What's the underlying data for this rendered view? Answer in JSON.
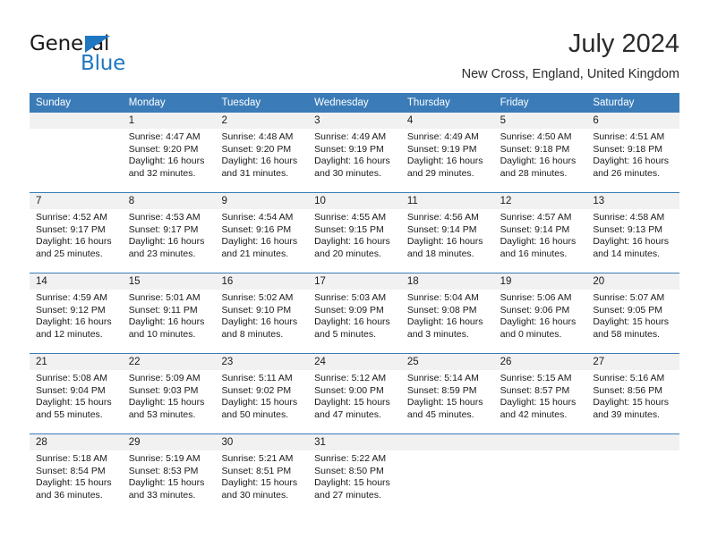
{
  "brand": {
    "word_one": "General",
    "word_two": "Blue",
    "triangle_color": "#1f77c2"
  },
  "header": {
    "month_title": "July 2024",
    "location": "New Cross, England, United Kingdom",
    "header_bg": "#3b7cb8",
    "number_band_bg": "#f1f1f1"
  },
  "calendar": {
    "weekday_headers": [
      "Sunday",
      "Monday",
      "Tuesday",
      "Wednesday",
      "Thursday",
      "Friday",
      "Saturday"
    ],
    "weeks": [
      [
        {
          "day": "",
          "sunrise": "",
          "sunset": "",
          "daylight_line1": "",
          "daylight_line2": ""
        },
        {
          "day": "1",
          "sunrise": "Sunrise: 4:47 AM",
          "sunset": "Sunset: 9:20 PM",
          "daylight_line1": "Daylight: 16 hours",
          "daylight_line2": "and 32 minutes."
        },
        {
          "day": "2",
          "sunrise": "Sunrise: 4:48 AM",
          "sunset": "Sunset: 9:20 PM",
          "daylight_line1": "Daylight: 16 hours",
          "daylight_line2": "and 31 minutes."
        },
        {
          "day": "3",
          "sunrise": "Sunrise: 4:49 AM",
          "sunset": "Sunset: 9:19 PM",
          "daylight_line1": "Daylight: 16 hours",
          "daylight_line2": "and 30 minutes."
        },
        {
          "day": "4",
          "sunrise": "Sunrise: 4:49 AM",
          "sunset": "Sunset: 9:19 PM",
          "daylight_line1": "Daylight: 16 hours",
          "daylight_line2": "and 29 minutes."
        },
        {
          "day": "5",
          "sunrise": "Sunrise: 4:50 AM",
          "sunset": "Sunset: 9:18 PM",
          "daylight_line1": "Daylight: 16 hours",
          "daylight_line2": "and 28 minutes."
        },
        {
          "day": "6",
          "sunrise": "Sunrise: 4:51 AM",
          "sunset": "Sunset: 9:18 PM",
          "daylight_line1": "Daylight: 16 hours",
          "daylight_line2": "and 26 minutes."
        }
      ],
      [
        {
          "day": "7",
          "sunrise": "Sunrise: 4:52 AM",
          "sunset": "Sunset: 9:17 PM",
          "daylight_line1": "Daylight: 16 hours",
          "daylight_line2": "and 25 minutes."
        },
        {
          "day": "8",
          "sunrise": "Sunrise: 4:53 AM",
          "sunset": "Sunset: 9:17 PM",
          "daylight_line1": "Daylight: 16 hours",
          "daylight_line2": "and 23 minutes."
        },
        {
          "day": "9",
          "sunrise": "Sunrise: 4:54 AM",
          "sunset": "Sunset: 9:16 PM",
          "daylight_line1": "Daylight: 16 hours",
          "daylight_line2": "and 21 minutes."
        },
        {
          "day": "10",
          "sunrise": "Sunrise: 4:55 AM",
          "sunset": "Sunset: 9:15 PM",
          "daylight_line1": "Daylight: 16 hours",
          "daylight_line2": "and 20 minutes."
        },
        {
          "day": "11",
          "sunrise": "Sunrise: 4:56 AM",
          "sunset": "Sunset: 9:14 PM",
          "daylight_line1": "Daylight: 16 hours",
          "daylight_line2": "and 18 minutes."
        },
        {
          "day": "12",
          "sunrise": "Sunrise: 4:57 AM",
          "sunset": "Sunset: 9:14 PM",
          "daylight_line1": "Daylight: 16 hours",
          "daylight_line2": "and 16 minutes."
        },
        {
          "day": "13",
          "sunrise": "Sunrise: 4:58 AM",
          "sunset": "Sunset: 9:13 PM",
          "daylight_line1": "Daylight: 16 hours",
          "daylight_line2": "and 14 minutes."
        }
      ],
      [
        {
          "day": "14",
          "sunrise": "Sunrise: 4:59 AM",
          "sunset": "Sunset: 9:12 PM",
          "daylight_line1": "Daylight: 16 hours",
          "daylight_line2": "and 12 minutes."
        },
        {
          "day": "15",
          "sunrise": "Sunrise: 5:01 AM",
          "sunset": "Sunset: 9:11 PM",
          "daylight_line1": "Daylight: 16 hours",
          "daylight_line2": "and 10 minutes."
        },
        {
          "day": "16",
          "sunrise": "Sunrise: 5:02 AM",
          "sunset": "Sunset: 9:10 PM",
          "daylight_line1": "Daylight: 16 hours",
          "daylight_line2": "and 8 minutes."
        },
        {
          "day": "17",
          "sunrise": "Sunrise: 5:03 AM",
          "sunset": "Sunset: 9:09 PM",
          "daylight_line1": "Daylight: 16 hours",
          "daylight_line2": "and 5 minutes."
        },
        {
          "day": "18",
          "sunrise": "Sunrise: 5:04 AM",
          "sunset": "Sunset: 9:08 PM",
          "daylight_line1": "Daylight: 16 hours",
          "daylight_line2": "and 3 minutes."
        },
        {
          "day": "19",
          "sunrise": "Sunrise: 5:06 AM",
          "sunset": "Sunset: 9:06 PM",
          "daylight_line1": "Daylight: 16 hours",
          "daylight_line2": "and 0 minutes."
        },
        {
          "day": "20",
          "sunrise": "Sunrise: 5:07 AM",
          "sunset": "Sunset: 9:05 PM",
          "daylight_line1": "Daylight: 15 hours",
          "daylight_line2": "and 58 minutes."
        }
      ],
      [
        {
          "day": "21",
          "sunrise": "Sunrise: 5:08 AM",
          "sunset": "Sunset: 9:04 PM",
          "daylight_line1": "Daylight: 15 hours",
          "daylight_line2": "and 55 minutes."
        },
        {
          "day": "22",
          "sunrise": "Sunrise: 5:09 AM",
          "sunset": "Sunset: 9:03 PM",
          "daylight_line1": "Daylight: 15 hours",
          "daylight_line2": "and 53 minutes."
        },
        {
          "day": "23",
          "sunrise": "Sunrise: 5:11 AM",
          "sunset": "Sunset: 9:02 PM",
          "daylight_line1": "Daylight: 15 hours",
          "daylight_line2": "and 50 minutes."
        },
        {
          "day": "24",
          "sunrise": "Sunrise: 5:12 AM",
          "sunset": "Sunset: 9:00 PM",
          "daylight_line1": "Daylight: 15 hours",
          "daylight_line2": "and 47 minutes."
        },
        {
          "day": "25",
          "sunrise": "Sunrise: 5:14 AM",
          "sunset": "Sunset: 8:59 PM",
          "daylight_line1": "Daylight: 15 hours",
          "daylight_line2": "and 45 minutes."
        },
        {
          "day": "26",
          "sunrise": "Sunrise: 5:15 AM",
          "sunset": "Sunset: 8:57 PM",
          "daylight_line1": "Daylight: 15 hours",
          "daylight_line2": "and 42 minutes."
        },
        {
          "day": "27",
          "sunrise": "Sunrise: 5:16 AM",
          "sunset": "Sunset: 8:56 PM",
          "daylight_line1": "Daylight: 15 hours",
          "daylight_line2": "and 39 minutes."
        }
      ],
      [
        {
          "day": "28",
          "sunrise": "Sunrise: 5:18 AM",
          "sunset": "Sunset: 8:54 PM",
          "daylight_line1": "Daylight: 15 hours",
          "daylight_line2": "and 36 minutes."
        },
        {
          "day": "29",
          "sunrise": "Sunrise: 5:19 AM",
          "sunset": "Sunset: 8:53 PM",
          "daylight_line1": "Daylight: 15 hours",
          "daylight_line2": "and 33 minutes."
        },
        {
          "day": "30",
          "sunrise": "Sunrise: 5:21 AM",
          "sunset": "Sunset: 8:51 PM",
          "daylight_line1": "Daylight: 15 hours",
          "daylight_line2": "and 30 minutes."
        },
        {
          "day": "31",
          "sunrise": "Sunrise: 5:22 AM",
          "sunset": "Sunset: 8:50 PM",
          "daylight_line1": "Daylight: 15 hours",
          "daylight_line2": "and 27 minutes."
        },
        {
          "day": "",
          "sunrise": "",
          "sunset": "",
          "daylight_line1": "",
          "daylight_line2": ""
        },
        {
          "day": "",
          "sunrise": "",
          "sunset": "",
          "daylight_line1": "",
          "daylight_line2": ""
        },
        {
          "day": "",
          "sunrise": "",
          "sunset": "",
          "daylight_line1": "",
          "daylight_line2": ""
        }
      ]
    ]
  }
}
